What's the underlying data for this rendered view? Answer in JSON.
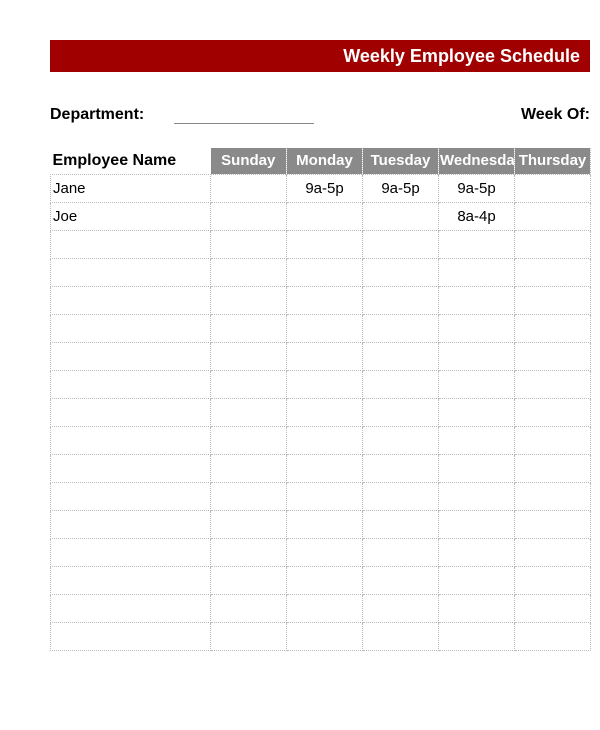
{
  "header": {
    "title": "Weekly Employee Schedule"
  },
  "meta": {
    "department_label": "Department:",
    "department_value": "",
    "week_of_label": "Week Of:"
  },
  "table": {
    "name_header": "Employee Name",
    "day_headers": [
      "Sunday",
      "Monday",
      "Tuesday",
      "Wednesday",
      "Thursday"
    ],
    "rows": [
      {
        "name": "Jane",
        "shifts": [
          "",
          "9a-5p",
          "9a-5p",
          "9a-5p",
          ""
        ]
      },
      {
        "name": "Joe",
        "shifts": [
          "",
          "",
          "",
          "8a-4p",
          ""
        ]
      },
      {
        "name": "",
        "shifts": [
          "",
          "",
          "",
          "",
          ""
        ]
      },
      {
        "name": "",
        "shifts": [
          "",
          "",
          "",
          "",
          ""
        ]
      },
      {
        "name": "",
        "shifts": [
          "",
          "",
          "",
          "",
          ""
        ]
      },
      {
        "name": "",
        "shifts": [
          "",
          "",
          "",
          "",
          ""
        ]
      },
      {
        "name": "",
        "shifts": [
          "",
          "",
          "",
          "",
          ""
        ]
      },
      {
        "name": "",
        "shifts": [
          "",
          "",
          "",
          "",
          ""
        ]
      },
      {
        "name": "",
        "shifts": [
          "",
          "",
          "",
          "",
          ""
        ]
      },
      {
        "name": "",
        "shifts": [
          "",
          "",
          "",
          "",
          ""
        ]
      },
      {
        "name": "",
        "shifts": [
          "",
          "",
          "",
          "",
          ""
        ]
      },
      {
        "name": "",
        "shifts": [
          "",
          "",
          "",
          "",
          ""
        ]
      },
      {
        "name": "",
        "shifts": [
          "",
          "",
          "",
          "",
          ""
        ]
      },
      {
        "name": "",
        "shifts": [
          "",
          "",
          "",
          "",
          ""
        ]
      },
      {
        "name": "",
        "shifts": [
          "",
          "",
          "",
          "",
          ""
        ]
      },
      {
        "name": "",
        "shifts": [
          "",
          "",
          "",
          "",
          ""
        ]
      },
      {
        "name": "",
        "shifts": [
          "",
          "",
          "",
          "",
          ""
        ]
      }
    ]
  }
}
